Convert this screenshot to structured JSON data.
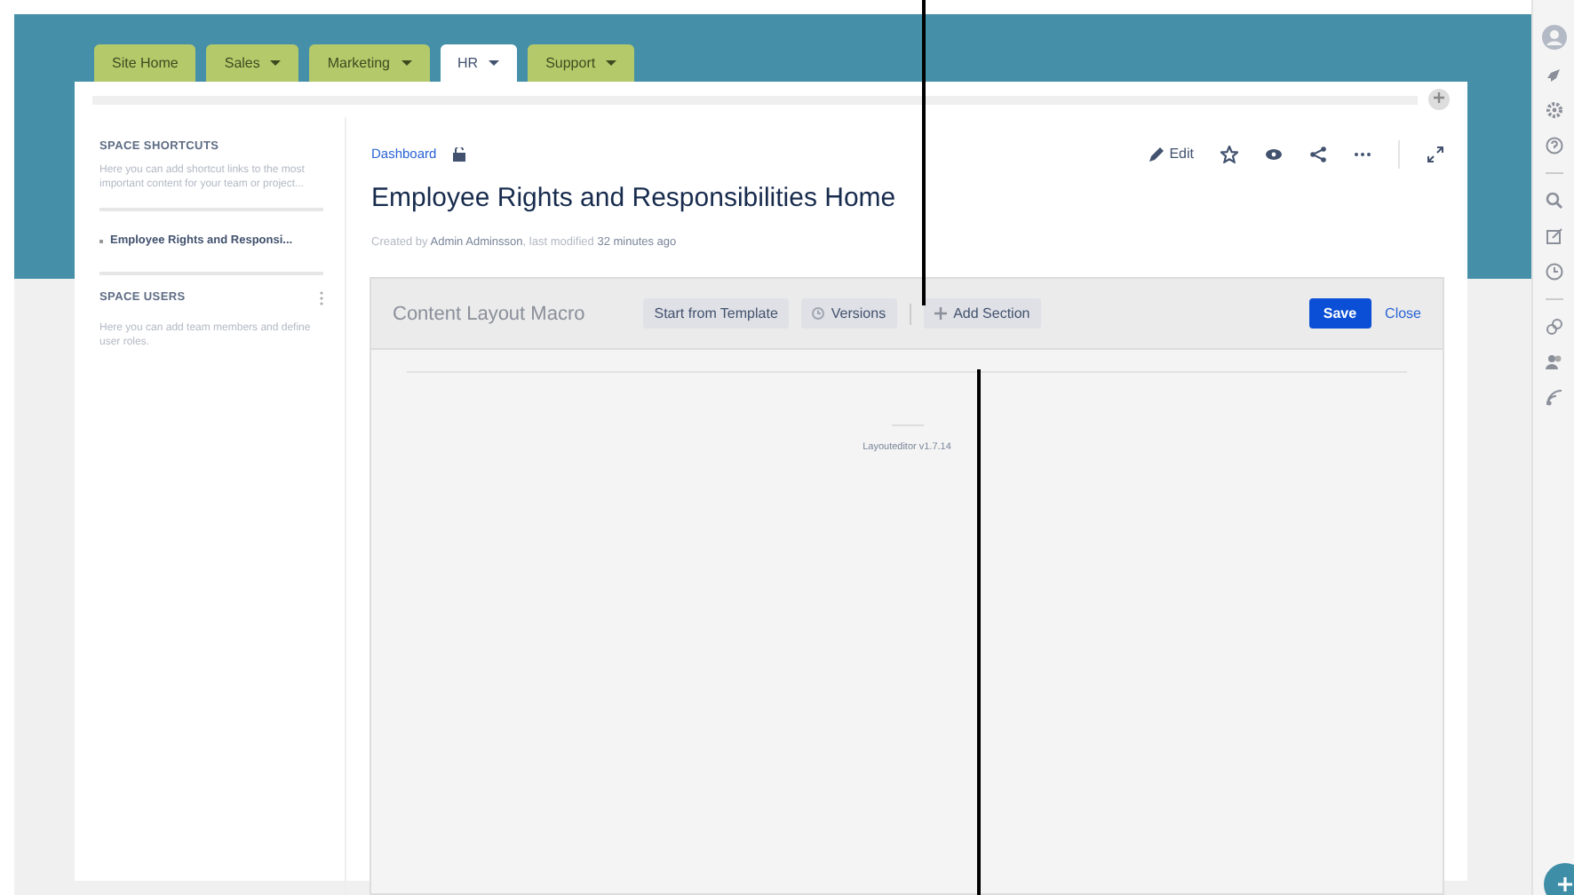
{
  "tabs": [
    {
      "label": "Site Home",
      "has_menu": false,
      "selected": false
    },
    {
      "label": "Sales",
      "has_menu": true,
      "selected": false
    },
    {
      "label": "Marketing",
      "has_menu": true,
      "selected": false
    },
    {
      "label": "HR",
      "has_menu": true,
      "selected": true
    },
    {
      "label": "Support",
      "has_menu": true,
      "selected": false
    }
  ],
  "sidebar": {
    "shortcuts_title": "SPACE SHORTCUTS",
    "shortcuts_hint": "Here you can add shortcut links to the most important content for your team or project...",
    "shortcut_items": [
      {
        "label": "Employee Rights and Responsi..."
      }
    ],
    "users_title": "SPACE USERS",
    "users_hint": "Here you can add team members and define user roles."
  },
  "page": {
    "breadcrumb": "Dashboard",
    "title": "Employee Rights and Responsibilities Home",
    "byline": [
      {
        "text": "Created by ",
        "emphasis": false
      },
      {
        "text": "Admin Adminsson",
        "emphasis": true
      },
      {
        "text": ", last modified ",
        "emphasis": false
      },
      {
        "text": "32 minutes ago",
        "emphasis": true
      }
    ],
    "actions": [
      {
        "kind": "edit",
        "label": "Edit"
      },
      {
        "kind": "star"
      },
      {
        "kind": "watch"
      },
      {
        "kind": "share"
      },
      {
        "kind": "more"
      },
      {
        "kind": "expand"
      }
    ]
  },
  "macro": {
    "title": "Content Layout Macro",
    "tools": [
      {
        "kind": "template",
        "label": "Start from Template"
      },
      {
        "kind": "versions",
        "label": "Versions"
      },
      {
        "kind": "add",
        "label": "Add Section"
      }
    ],
    "save": "Save",
    "close": "Close",
    "version": "Layouteditor v1.7.14"
  }
}
